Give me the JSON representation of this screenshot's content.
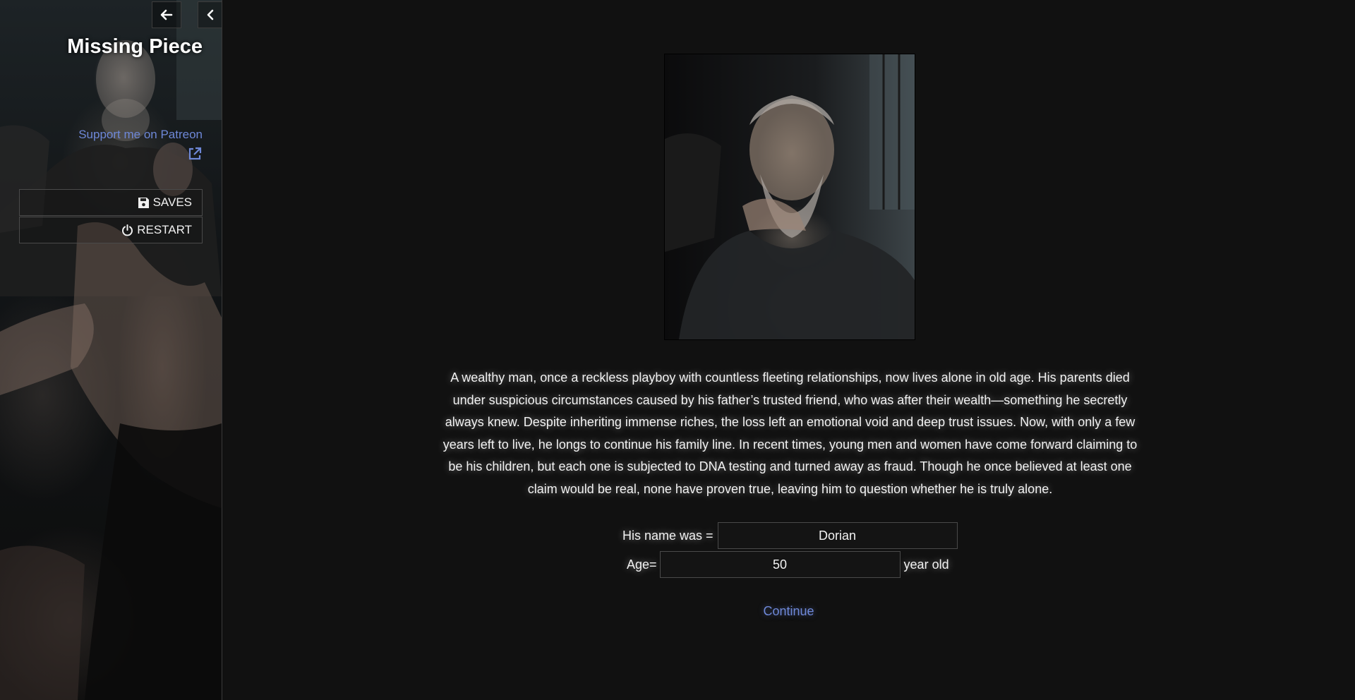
{
  "sidebar": {
    "title": "Missing Piece",
    "patreon_link": "Support me on Patreon",
    "saves_label": "SAVES",
    "restart_label": "RESTART"
  },
  "passage": {
    "story_text": "A wealthy man, once a reckless playboy with countless fleeting relationships, now lives alone in old age. His parents died under suspicious circumstances caused by his father’s trusted friend, who was after their wealth—something he secretly always knew. Despite inheriting immense riches, the loss left an emotional void and deep trust issues. Now, with only a few years left to live, he longs to continue his family line. In recent times, young men and women have come forward claiming to be his children, but each one is subjected to DNA testing and turned away as fraud. Though he once believed at least one claim would be real, none have proven true, leaving him to question whether he is truly alone.",
    "name_label": "His name was =",
    "name_value": "Dorian",
    "age_label": "Age=",
    "age_value": "50",
    "age_suffix": "year old",
    "continue_label": "Continue"
  },
  "colors": {
    "background": "#111111",
    "link": "#6e88d8",
    "text": "#f2f2f2"
  },
  "icons": {
    "back": "arrow-left-icon",
    "collapse": "chevron-left-icon",
    "external": "external-link-icon",
    "saves": "floppy-disk-icon",
    "restart": "power-icon"
  }
}
